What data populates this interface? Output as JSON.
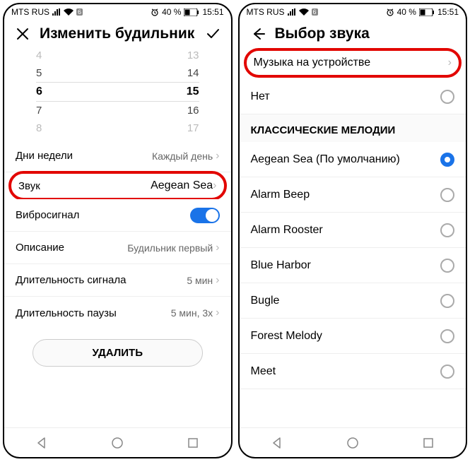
{
  "status": {
    "carrier": "MTS RUS",
    "sim_badge": "6",
    "battery_pct": "40 %",
    "time": "15:51"
  },
  "left": {
    "title": "Изменить будильник",
    "picker": {
      "hours": [
        "4",
        "5",
        "6",
        "7",
        "8"
      ],
      "minutes": [
        "13",
        "14",
        "15",
        "16",
        "17"
      ]
    },
    "rows": {
      "days_label": "Дни недели",
      "days_value": "Каждый день",
      "sound_label": "Звук",
      "sound_value": "Aegean Sea",
      "vibro_label": "Вибросигнал",
      "desc_label": "Описание",
      "desc_value": "Будильник первый",
      "signal_len_label": "Длительность сигнала",
      "signal_len_value": "5 мин",
      "pause_len_label": "Длительность паузы",
      "pause_len_value": "5 мин, 3x"
    },
    "delete_label": "УДАЛИТЬ"
  },
  "right": {
    "title": "Выбор звука",
    "music_row": "Музыка на устройстве",
    "none_label": "Нет",
    "section_title": "КЛАССИЧЕСКИЕ МЕЛОДИИ",
    "options": [
      {
        "label": "Aegean Sea (По умолчанию)",
        "selected": true
      },
      {
        "label": "Alarm Beep",
        "selected": false
      },
      {
        "label": "Alarm Rooster",
        "selected": false
      },
      {
        "label": "Blue Harbor",
        "selected": false
      },
      {
        "label": "Bugle",
        "selected": false
      },
      {
        "label": "Forest Melody",
        "selected": false
      },
      {
        "label": "Meet",
        "selected": false
      }
    ]
  }
}
